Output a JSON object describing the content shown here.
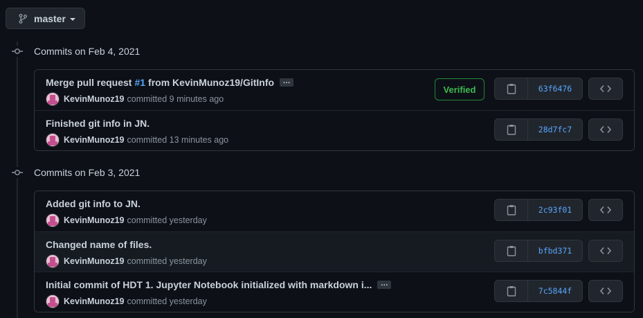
{
  "branch": {
    "name": "master",
    "icon": "git-branch-icon"
  },
  "groups": [
    {
      "date_label": "Commits on Feb 4, 2021",
      "commits": [
        {
          "message_prefix": "Merge pull request ",
          "issue": "#1",
          "message_suffix": " from KevinMunoz19/GitInfo",
          "has_more": true,
          "more_label": "…",
          "author": "KevinMunoz19",
          "action": "committed",
          "time": "9 minutes ago",
          "verified": "Verified",
          "sha": "63f6476"
        },
        {
          "message_prefix": "Finished git info in JN.",
          "issue": "",
          "message_suffix": "",
          "has_more": false,
          "more_label": "",
          "author": "KevinMunoz19",
          "action": "committed",
          "time": "13 minutes ago",
          "verified": "",
          "sha": "28d7fc7"
        }
      ]
    },
    {
      "date_label": "Commits on Feb 3, 2021",
      "commits": [
        {
          "message_prefix": "Added git info to JN.",
          "issue": "",
          "message_suffix": "",
          "has_more": false,
          "more_label": "",
          "author": "KevinMunoz19",
          "action": "committed",
          "time": "yesterday",
          "verified": "",
          "sha": "2c93f01"
        },
        {
          "message_prefix": "Changed name of files.",
          "issue": "",
          "message_suffix": "",
          "has_more": false,
          "more_label": "",
          "author": "KevinMunoz19",
          "action": "committed",
          "time": "yesterday",
          "verified": "",
          "sha": "bfbd371"
        },
        {
          "message_prefix": "Initial commit of HDT 1. Jupyter Notebook initialized with markdown i...",
          "issue": "",
          "message_suffix": "",
          "has_more": true,
          "more_label": "…",
          "author": "KevinMunoz19",
          "action": "committed",
          "time": "yesterday",
          "verified": "",
          "sha": "7c5844f"
        }
      ]
    }
  ],
  "colors": {
    "background": "#0d1117",
    "link": "#58a6ff",
    "verified": "#3fb950",
    "border": "#30363d"
  }
}
